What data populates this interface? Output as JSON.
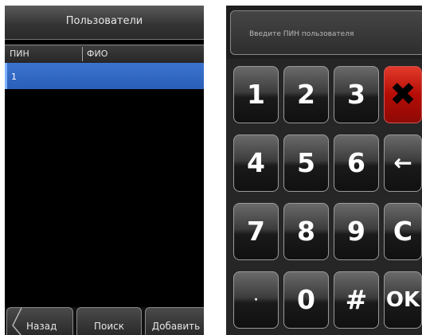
{
  "users_screen": {
    "title": "Пользователи",
    "columns": [
      "ПИН",
      "ФИО"
    ],
    "rows": [
      {
        "pin": "1",
        "name": ""
      }
    ],
    "buttons": {
      "back": "Назад",
      "search": "Поиск",
      "add": "Добавить"
    }
  },
  "pin_screen": {
    "placeholder": "Введите ПИН пользователя",
    "keys": {
      "k1": "1",
      "k2": "2",
      "k3": "3",
      "delete": "✖",
      "k4": "4",
      "k5": "5",
      "k6": "6",
      "backspace": "←",
      "k7": "7",
      "k8": "8",
      "k9": "9",
      "clear": "C",
      "dot": "·",
      "k0": "0",
      "hash": "#",
      "ok": "OK"
    }
  },
  "colors": {
    "selected_row": "#2f65c0",
    "delete_key": "#c8140a"
  }
}
